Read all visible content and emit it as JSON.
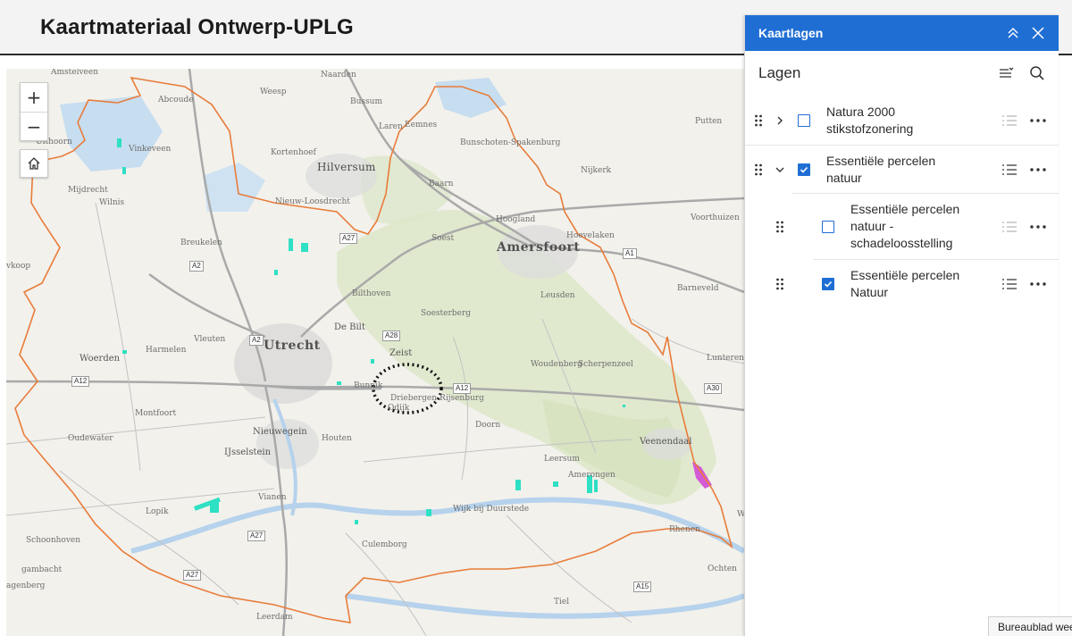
{
  "header": {
    "title": "Kaartmateriaal Ontwerp-UPLG"
  },
  "map": {
    "controls": {
      "zoom_in": "+",
      "zoom_out": "−"
    },
    "colors": {
      "boundary": "#e87c3a",
      "natuur": "#2ee0c4",
      "natura2000": "#d45ad6",
      "forest": "#d7e3c0",
      "water": "#bcd6ee",
      "road": "#a9a9a9"
    },
    "labels": {
      "amstelveen": "Amstelveen",
      "abcoude": "Abcoude",
      "uithoorn": "Uithoorn",
      "vinkeveen": "Vinkeveen",
      "mijdrecht": "Mijdrecht",
      "wilnis": "Wilnis",
      "naarden": "Naarden",
      "weesp": "Weesp",
      "bussum": "Bussum",
      "laren": "Laren",
      "eemnes": "Eemnes",
      "kortenhoef": "Kortenhoef",
      "hilversum": "Hilversum",
      "nieuw_loosdrecht": "Nieuw-Loosdrecht",
      "bunschoten": "Bunschoten-Spakenburg",
      "putten": "Putten",
      "nijkerk": "Nijkerk",
      "baarn": "Baarn",
      "hoogland": "Hoogland",
      "voorthuizen": "Voorthuizen",
      "breukelen": "Breukelen",
      "soest": "Soest",
      "amersfoort": "Amersfoort",
      "hoevelaken": "Hoevelaken",
      "woerden_west": "vkoop",
      "bilthoven": "Bilthoven",
      "leusden": "Leusden",
      "barneveld": "Barneveld",
      "soesterberg": "Soesterberg",
      "harmelen": "Harmelen",
      "vleuten": "Vleuten",
      "de_bilt": "De Bilt",
      "utrecht": "Utrecht",
      "woerden": "Woerden",
      "zeist": "Zeist",
      "woudenberg": "Woudenberg",
      "scherpenzeel": "Scherpenzeel",
      "lunteren": "Lunteren",
      "bunnik": "Bunnik",
      "driebergen": "Driebergen-Rijsenburg",
      "odijk": "Odijk",
      "montfoort": "Montfoort",
      "oudewater": "Oudewater",
      "nieuwegein": "Nieuwegein",
      "houten": "Houten",
      "doorn": "Doorn",
      "veenendaal": "Veenendaal",
      "ijsselstein": "IJsselstein",
      "leersum": "Leersum",
      "amerongen": "Amerongen",
      "vianen": "Vianen",
      "lopik": "Lopik",
      "wijk": "Wijk bij Duurstede",
      "rhenen": "Rhenen",
      "schoonhoven": "Schoonhoven",
      "culemborg": "Culemborg",
      "gambacht": "gambacht",
      "ochten": "Ochten",
      "tiel": "Tiel",
      "leerdam": "Leerdam",
      "wagenberg": "agenberg",
      "wageningen_r": "Wa"
    },
    "roads": {
      "a27_north": "A27",
      "a2_north": "A2",
      "a1": "A1",
      "a28": "A28",
      "a2_mid": "A2",
      "a12_west": "A12",
      "a12_east": "A12",
      "a30": "A30",
      "a27_south": "A27",
      "a27_sw": "A27",
      "a15": "A15"
    }
  },
  "panel": {
    "title": "Kaartlagen",
    "subtitle": "Lagen",
    "layers": [
      {
        "label_line1": "Natura 2000",
        "label_line2": "stikstofzonering",
        "checked": false,
        "expanded": false
      },
      {
        "label_line1": "Essentiële percelen",
        "label_line2": "natuur",
        "checked": true,
        "expanded": true
      },
      {
        "label_line1": "Essentiële percelen",
        "label_line2": "natuur -",
        "label_line3": "schadeloosstelling",
        "checked": false
      },
      {
        "label_line1": "Essentiële percelen",
        "label_line2": "Natuur",
        "checked": true
      }
    ]
  },
  "status": {
    "text": "Bureaublad wee"
  }
}
